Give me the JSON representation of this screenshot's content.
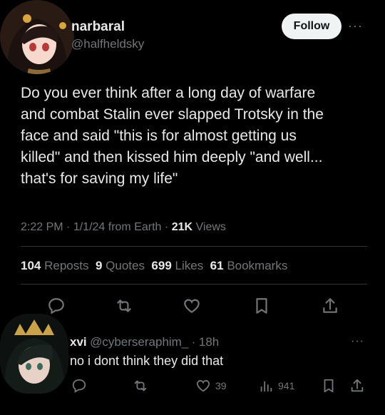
{
  "tweet": {
    "display_name": "narbaral",
    "handle": "@halfheldsky",
    "follow_label": "Follow",
    "more_label": "···",
    "text": "Do you ever think after a long day of warfare\nand combat Stalin ever slapped Trotsky in the\nface and said \"this is for almost getting us\nkilled\" and then kissed him deeply \"and well...\nthat's for saving my life\"",
    "time": "2:22 PM",
    "sep1": "·",
    "date": "1/1/24 from Earth",
    "sep2": "·",
    "views_count": "21K",
    "views_label": "Views",
    "stats": {
      "reposts_count": "104",
      "reposts_label": "Reposts",
      "quotes_count": "9",
      "quotes_label": "Quotes",
      "likes_count": "699",
      "likes_label": "Likes",
      "bookmarks_count": "61",
      "bookmarks_label": "Bookmarks"
    },
    "actions": [
      "reply-icon",
      "repost-icon",
      "like-icon",
      "bookmark-icon",
      "share-icon"
    ]
  },
  "reply": {
    "display_name": "xvi",
    "handle": "@cyberseraphim_",
    "sep": "·",
    "time": "18h",
    "more_label": "···",
    "text": "no i dont think they did that",
    "likes": "39",
    "views": "941"
  },
  "colors": {
    "background": "#000000",
    "text": "#e7e9ea",
    "muted": "#71767b",
    "divider": "#2f3336",
    "follow_bg": "#eff3f4"
  }
}
